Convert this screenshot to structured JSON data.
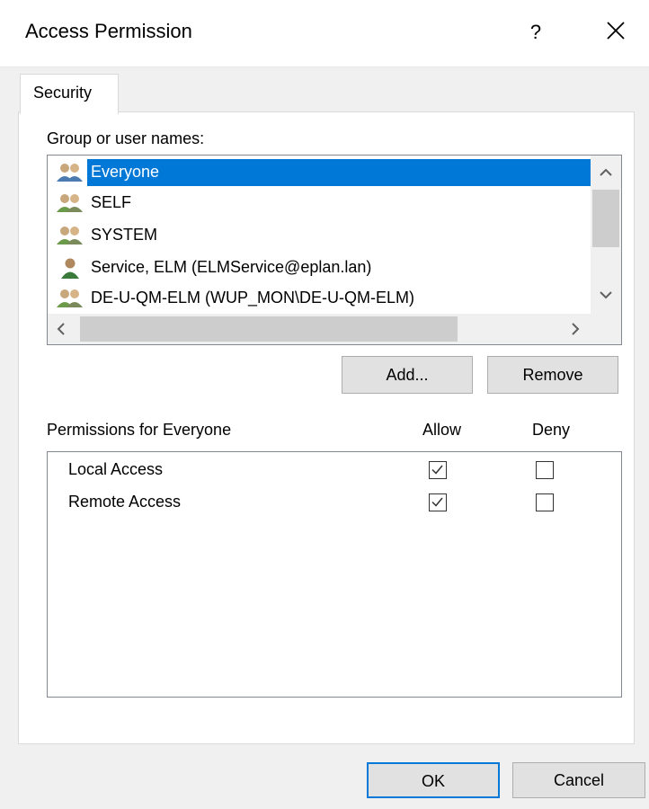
{
  "window": {
    "title": "Access Permission",
    "help_label": "?"
  },
  "tabs": [
    {
      "label": "Security"
    }
  ],
  "users": {
    "label": "Group or user names:",
    "items": [
      {
        "label": "Everyone",
        "icon": "group-icon",
        "selected": true
      },
      {
        "label": "SELF",
        "icon": "group-icon"
      },
      {
        "label": "SYSTEM",
        "icon": "group-icon"
      },
      {
        "label": "Service, ELM (ELMService@eplan.lan)",
        "icon": "user-icon"
      },
      {
        "label": "DE-U-QM-ELM (WUP_MON\\DE-U-QM-ELM)",
        "icon": "group-icon"
      }
    ]
  },
  "buttons": {
    "add": "Add...",
    "remove": "Remove",
    "ok": "OK",
    "cancel": "Cancel"
  },
  "permissions": {
    "label": "Permissions for Everyone",
    "allow_header": "Allow",
    "deny_header": "Deny",
    "items": [
      {
        "label": "Local Access",
        "allow": true,
        "deny": false
      },
      {
        "label": "Remote Access",
        "allow": true,
        "deny": false
      }
    ]
  },
  "colors": {
    "selection": "#0078d7",
    "group_icon": "#4a7ab0",
    "user_icon": "#3a7a3a"
  }
}
